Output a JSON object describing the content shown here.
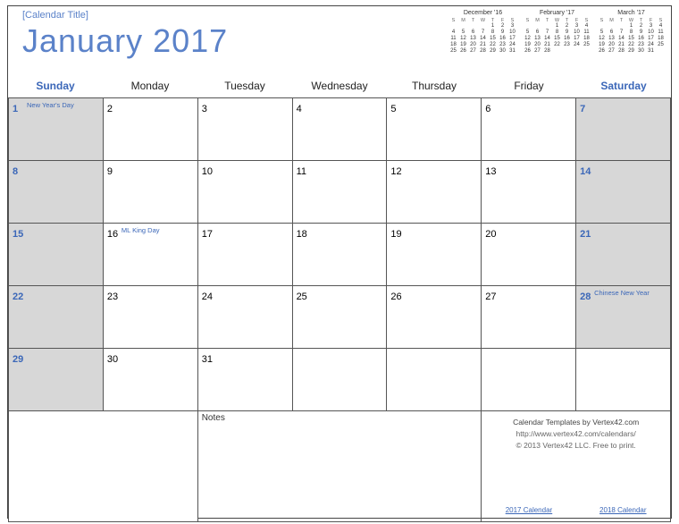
{
  "header": {
    "placeholder": "[Calendar Title]",
    "title": "January  2017"
  },
  "mini_calendars": [
    {
      "title": "December '16",
      "dow": [
        "S",
        "M",
        "T",
        "W",
        "T",
        "F",
        "S"
      ],
      "rows": [
        [
          "",
          "",
          "",
          "",
          "1",
          "2",
          "3"
        ],
        [
          "4",
          "5",
          "6",
          "7",
          "8",
          "9",
          "10"
        ],
        [
          "11",
          "12",
          "13",
          "14",
          "15",
          "16",
          "17"
        ],
        [
          "18",
          "19",
          "20",
          "21",
          "22",
          "23",
          "24"
        ],
        [
          "25",
          "26",
          "27",
          "28",
          "29",
          "30",
          "31"
        ]
      ]
    },
    {
      "title": "February '17",
      "dow": [
        "S",
        "M",
        "T",
        "W",
        "T",
        "F",
        "S"
      ],
      "rows": [
        [
          "",
          "",
          "",
          "1",
          "2",
          "3",
          "4"
        ],
        [
          "5",
          "6",
          "7",
          "8",
          "9",
          "10",
          "11"
        ],
        [
          "12",
          "13",
          "14",
          "15",
          "16",
          "17",
          "18"
        ],
        [
          "19",
          "20",
          "21",
          "22",
          "23",
          "24",
          "25"
        ],
        [
          "26",
          "27",
          "28",
          "",
          "",
          "",
          ""
        ]
      ]
    },
    {
      "title": "March '17",
      "dow": [
        "S",
        "M",
        "T",
        "W",
        "T",
        "F",
        "S"
      ],
      "rows": [
        [
          "",
          "",
          "",
          "1",
          "2",
          "3",
          "4"
        ],
        [
          "5",
          "6",
          "7",
          "8",
          "9",
          "10",
          "11"
        ],
        [
          "12",
          "13",
          "14",
          "15",
          "16",
          "17",
          "18"
        ],
        [
          "19",
          "20",
          "21",
          "22",
          "23",
          "24",
          "25"
        ],
        [
          "26",
          "27",
          "28",
          "29",
          "30",
          "31",
          ""
        ]
      ]
    }
  ],
  "dayhead": [
    "Sunday",
    "Monday",
    "Tuesday",
    "Wednesday",
    "Thursday",
    "Friday",
    "Saturday"
  ],
  "cells": [
    {
      "n": "1",
      "wknd": true,
      "event": "New Year's Day"
    },
    {
      "n": "2"
    },
    {
      "n": "3"
    },
    {
      "n": "4"
    },
    {
      "n": "5"
    },
    {
      "n": "6"
    },
    {
      "n": "7",
      "wknd": true
    },
    {
      "n": "8",
      "wknd": true
    },
    {
      "n": "9"
    },
    {
      "n": "10"
    },
    {
      "n": "11"
    },
    {
      "n": "12"
    },
    {
      "n": "13"
    },
    {
      "n": "14",
      "wknd": true
    },
    {
      "n": "15",
      "wknd": true
    },
    {
      "n": "16",
      "event": "ML King Day"
    },
    {
      "n": "17"
    },
    {
      "n": "18"
    },
    {
      "n": "19"
    },
    {
      "n": "20"
    },
    {
      "n": "21",
      "wknd": true
    },
    {
      "n": "22",
      "wknd": true
    },
    {
      "n": "23"
    },
    {
      "n": "24"
    },
    {
      "n": "25"
    },
    {
      "n": "26"
    },
    {
      "n": "27"
    },
    {
      "n": "28",
      "wknd": true,
      "event": "Chinese New Year"
    },
    {
      "n": "29",
      "wknd": true
    },
    {
      "n": "30"
    },
    {
      "n": "31"
    },
    {
      "n": ""
    },
    {
      "n": ""
    },
    {
      "n": ""
    },
    {
      "n": ""
    }
  ],
  "footer": {
    "notes_label": "Notes",
    "credit1": "Calendar Templates by Vertex42.com",
    "credit2": "http://www.vertex42.com/calendars/",
    "credit3": "© 2013 Vertex42 LLC. Free to print.",
    "link1": "2017 Calendar",
    "link2": "2018 Calendar"
  }
}
